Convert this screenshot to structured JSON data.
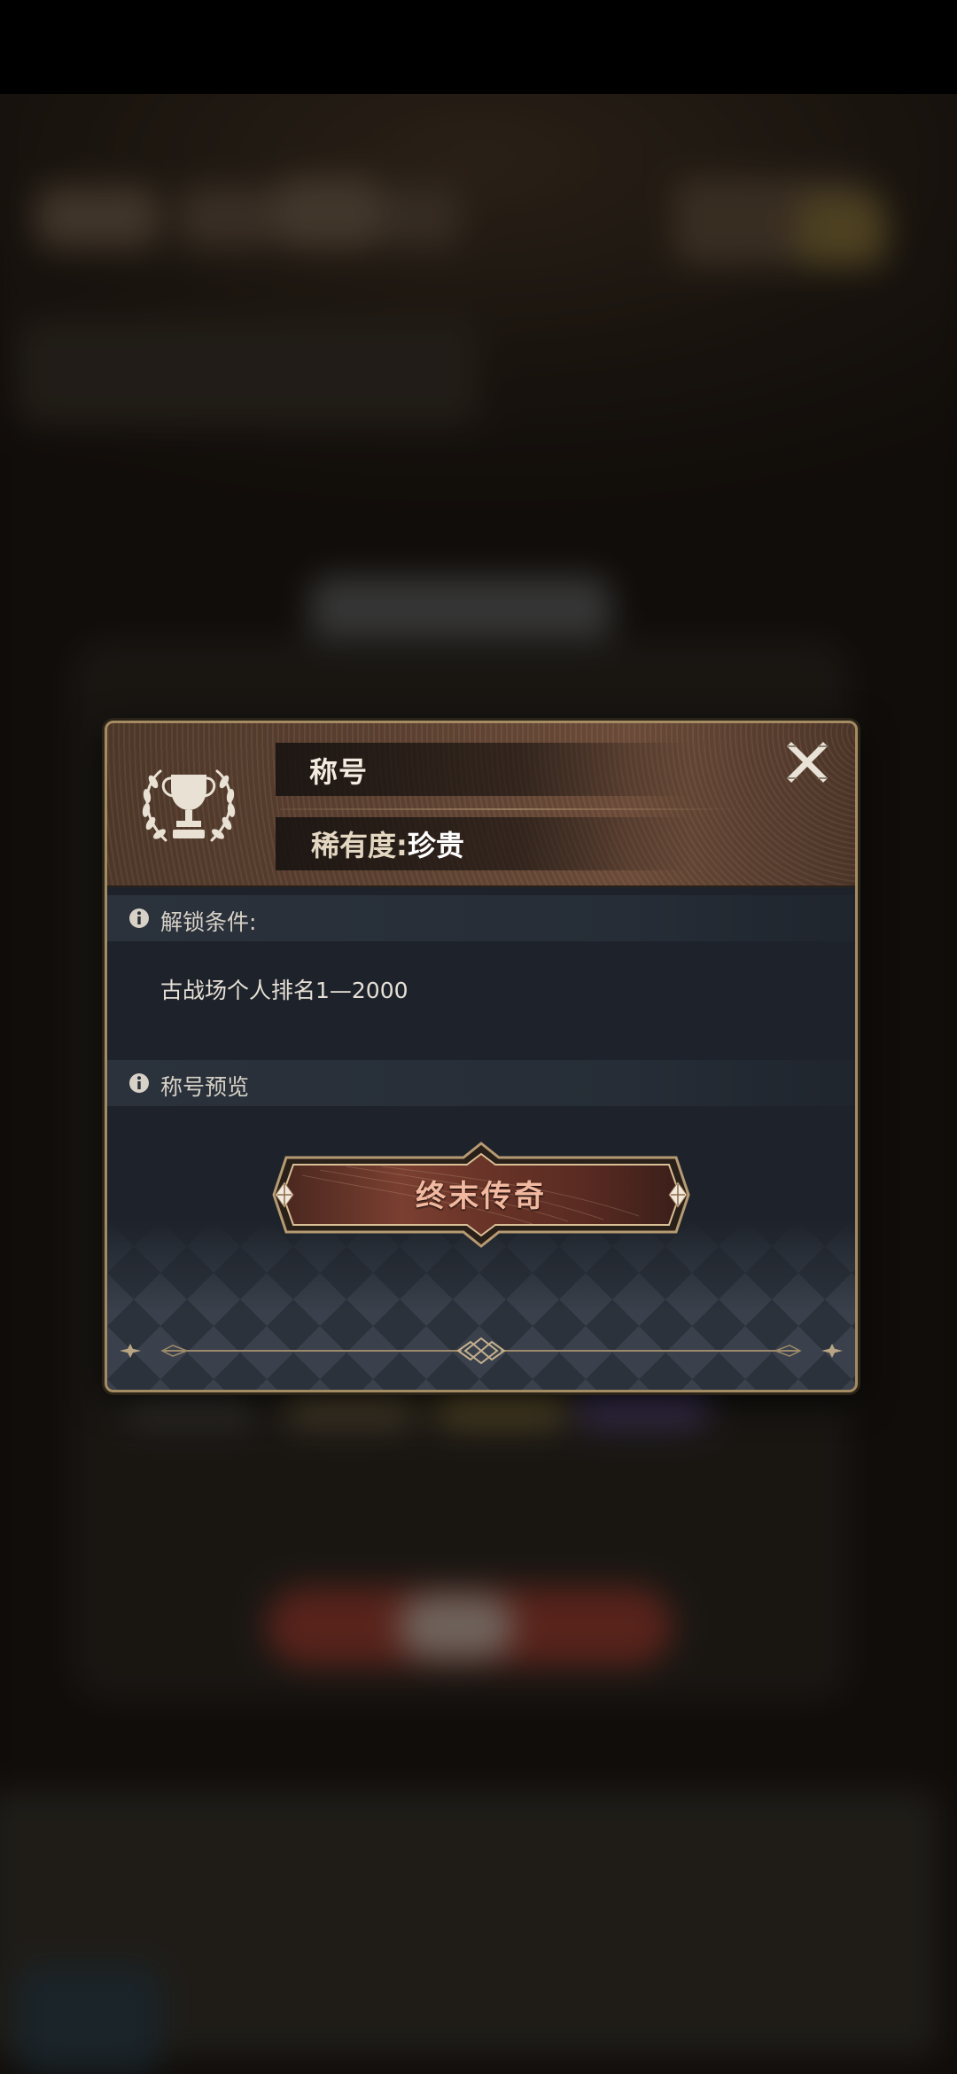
{
  "dialog": {
    "title": "称号",
    "rarity_label": "稀有度:",
    "rarity_value": "珍贵",
    "close_symbol": "X",
    "emblem_icon": "trophy-laurel-icon",
    "unlock_section": {
      "label": "解锁条件:",
      "condition": "古战场个人排名1—2000"
    },
    "preview_section": {
      "label": "称号预览",
      "title_name": "终末传奇"
    }
  },
  "colors": {
    "gold_border": "#a58b62",
    "header_brown": "#5b4031",
    "panel_bg": "#1e232b",
    "plate_text": "#f2b9a0"
  }
}
